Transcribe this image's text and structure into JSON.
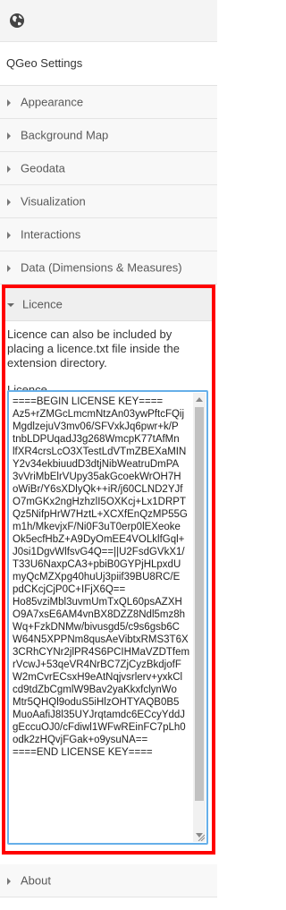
{
  "app": {
    "globe_icon": "globe-icon"
  },
  "header": {
    "title": "QGeo Settings"
  },
  "sections": [
    {
      "label": "Appearance"
    },
    {
      "label": "Background Map"
    },
    {
      "label": "Geodata"
    },
    {
      "label": "Visualization"
    },
    {
      "label": "Interactions"
    },
    {
      "label": "Data (Dimensions & Measures)"
    }
  ],
  "licence": {
    "header": "Licence",
    "description": "Licence can also be included by placing a licence.txt file inside the extension directory.",
    "field_label": "Licence",
    "lines": [
      "====BEGIN LICENSE KEY====",
      "Az5+rZMGcLmcmNtzAn03ywPftcFQij",
      "MgdlzejuV3mv06/SFVxkJq6pwr+k/P",
      "tnbLDPUqadJ3g268WmcpK77tAfMn",
      "lfXR4crsLcO3XTestLdVTmZBEXaMIN",
      "Y2v34ekbiuudD3dtjNibWeatruDmPA",
      "3vVriMbElrVUpy35akGcoekWrOH7H",
      "oWiBr/Y6sXDlyQk++iR/j60CLND2YJf",
      "O7mGKx2ngHzhzlI5OXKcj+Lx1DRPT",
      "Qz5NifpHrW7HztL+XCXfEnQzMP55G",
      "m1h/MkevjxF/Ni0F3uT0erp0lEXeoke",
      "Ok5ecfHbZ+A9DyOmEE4VOLklfGql+",
      "J0si1DgvWlfsvG4Q==||U2FsdGVkX1/",
      "T33U6NaxpCA3+pbiB0GYPjHLpxdU",
      "myQcMZXpg40huUj3piif39BU8RC/E",
      "pdCKcjCjP0C+IFjX6Q==",
      "Ho85vziMbl3uvmUmTxQL60psAZXH",
      "O9A7xsE6AM4vnBX8DZZ8Ndl5mz8h",
      "Wq+FzkDNMw/bivusgd5/c9s6gsb6C",
      "W64N5XPPNm8qusAeVibtxRMS3T6X",
      "3CRhCYNr2jlPR4S6PCIHMaVZDTfem",
      "rVcwJ+53qeVR4NrBC7ZjCyzBkdjofF",
      "W2mCvrECsxH9eAtNqjvsrlerv+yxkCl",
      "cd9tdZbCgmlW9Bav2yaKkxfclynWo",
      "Mtr5QHQl9oduS5iHlzOHTYAQB0B5",
      "MuoAafiJ8l35UYJrqtamdc6ECcyYddJ",
      "gEccuOJ0/cFdiwl1WFwREinFC7pLh0",
      "odk2zHQvjFGak+o9ysuNA==",
      "====END LICENSE KEY===="
    ]
  },
  "about": {
    "label": "About"
  },
  "colors": {
    "highlight_border": "#ff0000",
    "focus_border": "#66afe9"
  }
}
